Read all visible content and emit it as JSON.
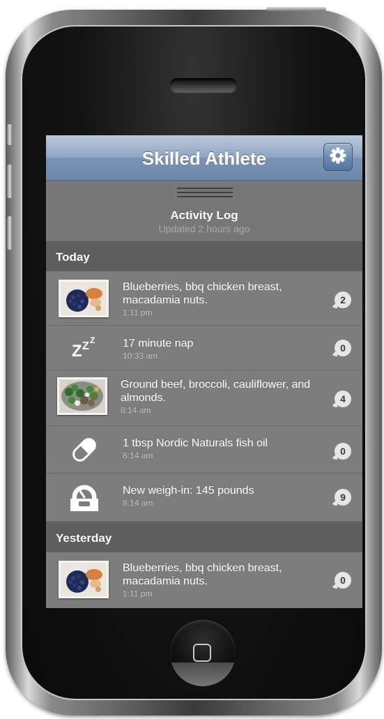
{
  "app": {
    "title": "Skilled Athlete",
    "settings_icon": "gear-icon"
  },
  "header": {
    "title": "Activity Log",
    "updated": "Updated 2 hours ago"
  },
  "sections": [
    {
      "label": "Today",
      "items": [
        {
          "icon": "food-photo-blueberries-chicken",
          "text": "Blueberries, bbq chicken breast, macadamia nuts.",
          "time": "1:11 pm",
          "comments": "2"
        },
        {
          "icon": "sleep-zzz-icon",
          "text": "17 minute nap",
          "time": "10:33 am",
          "comments": "0"
        },
        {
          "icon": "food-photo-beef-broccoli",
          "text": "Ground beef, broccoli, cauliflower, and almonds.",
          "time": "8:14 am",
          "comments": "4"
        },
        {
          "icon": "pill-icon",
          "text": "1 tbsp Nordic Naturals fish oil",
          "time": "8:14 am",
          "comments": "0"
        },
        {
          "icon": "scale-icon",
          "text": "New weigh-in: 145 pounds",
          "time": "8:14 am",
          "comments": "9"
        }
      ]
    },
    {
      "label": "Yesterday",
      "items": [
        {
          "icon": "food-photo-blueberries-chicken",
          "text": "Blueberries, bbq chicken breast, macadamia nuts.",
          "time": "1:11 pm",
          "comments": "0"
        }
      ]
    }
  ],
  "colors": {
    "navbar": "#8fa6c2",
    "list_bg": "#7d7d7d",
    "section_bg": "#5e5e5e",
    "badge_bg": "#e6e6e6"
  }
}
